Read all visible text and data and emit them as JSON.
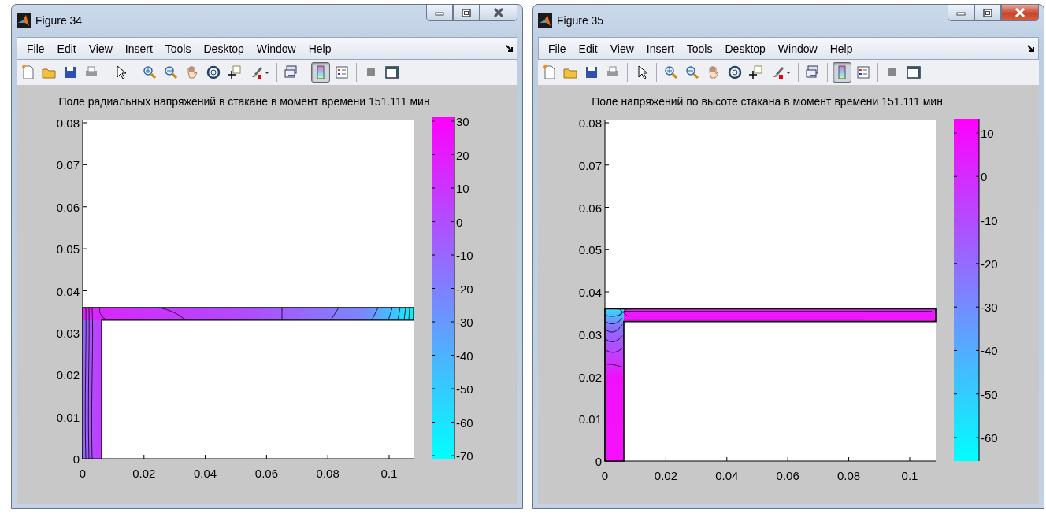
{
  "windows": [
    {
      "title": "Figure 34",
      "active": false,
      "menu": [
        "File",
        "Edit",
        "View",
        "Insert",
        "Tools",
        "Desktop",
        "Window",
        "Help"
      ],
      "toolbar": [
        {
          "kind": "new",
          "pressed": false
        },
        {
          "kind": "open",
          "pressed": false
        },
        {
          "kind": "save",
          "pressed": false
        },
        {
          "kind": "print",
          "pressed": false
        },
        {
          "kind": "separator"
        },
        {
          "kind": "pointer",
          "pressed": false
        },
        {
          "kind": "separator"
        },
        {
          "kind": "zoom-in",
          "pressed": false
        },
        {
          "kind": "zoom-out",
          "pressed": false
        },
        {
          "kind": "pan",
          "pressed": false
        },
        {
          "kind": "rotate",
          "pressed": false
        },
        {
          "kind": "data-cursor",
          "pressed": false
        },
        {
          "kind": "brush",
          "pressed": false
        },
        {
          "kind": "separator"
        },
        {
          "kind": "link",
          "pressed": false
        },
        {
          "kind": "separator"
        },
        {
          "kind": "colorbar",
          "pressed": true
        },
        {
          "kind": "legend",
          "pressed": false
        },
        {
          "kind": "separator"
        },
        {
          "kind": "hide-tools",
          "pressed": false
        },
        {
          "kind": "show-tools",
          "pressed": false
        }
      ],
      "plot": {
        "title": "Поле радиальных напряжений в стакане в момент времени 151.111 мин",
        "y_ticks": [
          "0.08",
          "0.07",
          "0.06",
          "0.05",
          "0.04",
          "0.03",
          "0.02",
          "0.01",
          "0"
        ],
        "x_ticks": [
          "0",
          "0.02",
          "0.04",
          "0.06",
          "0.08",
          "0.1"
        ],
        "colorbar_ticks": [
          "30",
          "20",
          "10",
          "0",
          "-10",
          "-20",
          "-30",
          "-40",
          "-50",
          "-60",
          "-70"
        ]
      }
    },
    {
      "title": "Figure 35",
      "active": true,
      "menu": [
        "File",
        "Edit",
        "View",
        "Insert",
        "Tools",
        "Desktop",
        "Window",
        "Help"
      ],
      "toolbar": [
        {
          "kind": "new",
          "pressed": false
        },
        {
          "kind": "open",
          "pressed": false
        },
        {
          "kind": "save",
          "pressed": false
        },
        {
          "kind": "print",
          "pressed": false
        },
        {
          "kind": "separator"
        },
        {
          "kind": "pointer",
          "pressed": false
        },
        {
          "kind": "separator"
        },
        {
          "kind": "zoom-in",
          "pressed": false
        },
        {
          "kind": "zoom-out",
          "pressed": false
        },
        {
          "kind": "pan",
          "pressed": false
        },
        {
          "kind": "rotate",
          "pressed": false
        },
        {
          "kind": "data-cursor",
          "pressed": false
        },
        {
          "kind": "brush",
          "pressed": false
        },
        {
          "kind": "separator"
        },
        {
          "kind": "link",
          "pressed": false
        },
        {
          "kind": "separator"
        },
        {
          "kind": "colorbar",
          "pressed": true
        },
        {
          "kind": "legend",
          "pressed": false
        },
        {
          "kind": "separator"
        },
        {
          "kind": "hide-tools",
          "pressed": false
        },
        {
          "kind": "show-tools",
          "pressed": false
        }
      ],
      "plot": {
        "title": "Поле напряжений по высоте стакана в момент времени 151.111 мин",
        "y_ticks": [
          "0.08",
          "0.07",
          "0.06",
          "0.05",
          "0.04",
          "0.03",
          "0.02",
          "0.01",
          "0"
        ],
        "x_ticks": [
          "0",
          "0.02",
          "0.04",
          "0.06",
          "0.08",
          "0.1"
        ],
        "colorbar_ticks": [
          "10",
          "0",
          "-10",
          "-20",
          "-30",
          "-40",
          "-50",
          "-60"
        ]
      }
    }
  ]
}
